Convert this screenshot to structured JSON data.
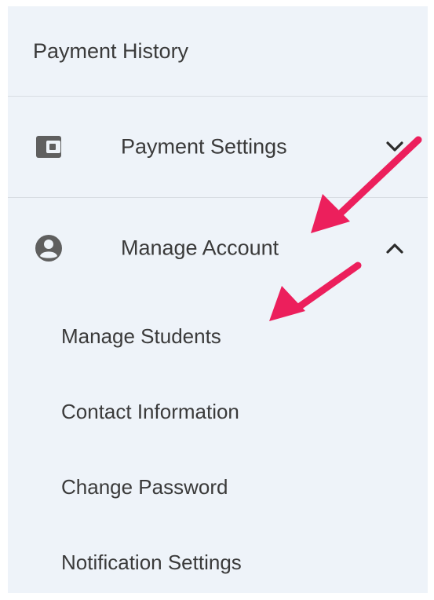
{
  "sidebar": {
    "top_item": {
      "label": "Payment History"
    },
    "sections": [
      {
        "label": "Payment Settings",
        "icon": "wallet-icon",
        "chevron": "chevron-down-icon",
        "expanded": false
      },
      {
        "label": "Manage Account",
        "icon": "account-circle-icon",
        "chevron": "chevron-up-icon",
        "expanded": true
      }
    ],
    "sub_items": [
      {
        "label": "Manage Students"
      },
      {
        "label": "Contact Information"
      },
      {
        "label": "Change Password"
      },
      {
        "label": "Notification Settings"
      }
    ]
  },
  "annotations": {
    "arrow_color": "#ec1f5c",
    "arrows": [
      {
        "points_to": "Manage Account"
      },
      {
        "points_to": "Manage Students"
      }
    ]
  },
  "colors": {
    "sidebar_background": "#eef3f9",
    "text": "#3a3a3a",
    "icon": "#5f5f5f",
    "divider": "#d8dde3"
  }
}
